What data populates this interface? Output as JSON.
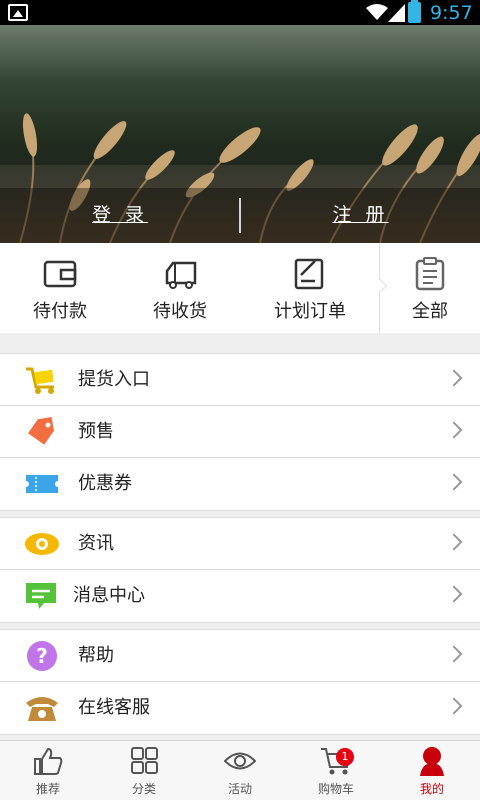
{
  "statusbar": {
    "time": "9:57"
  },
  "hero": {
    "login_label": "登 录",
    "register_label": "注 册"
  },
  "orders": [
    {
      "label": "待付款",
      "icon": "wallet-icon"
    },
    {
      "label": "待收货",
      "icon": "truck-icon"
    },
    {
      "label": "计划订单",
      "icon": "edit-note-icon"
    },
    {
      "label": "全部",
      "icon": "clipboard-icon"
    }
  ],
  "menu": {
    "group1": [
      {
        "label": "提货入口",
        "icon": "cart-delivery-icon"
      },
      {
        "label": "预售",
        "icon": "tag-icon"
      },
      {
        "label": "优惠券",
        "icon": "ticket-icon"
      }
    ],
    "group2": [
      {
        "label": "资讯",
        "icon": "eye-icon"
      },
      {
        "label": "消息中心",
        "icon": "message-icon"
      }
    ],
    "group3": [
      {
        "label": "帮助",
        "icon": "help-icon"
      },
      {
        "label": "在线客服",
        "icon": "telephone-icon"
      }
    ]
  },
  "bottomnav": [
    {
      "label": "推荐",
      "icon": "thumbs-up-icon"
    },
    {
      "label": "分类",
      "icon": "grid-icon"
    },
    {
      "label": "活动",
      "icon": "eye-icon"
    },
    {
      "label": "购物车",
      "icon": "cart-icon",
      "badge": "1"
    },
    {
      "label": "我的",
      "icon": "user-icon",
      "active": true
    }
  ],
  "colors": {
    "accent": "#c8000a",
    "badge": "#e60012",
    "status_blue": "#33b5e5"
  }
}
